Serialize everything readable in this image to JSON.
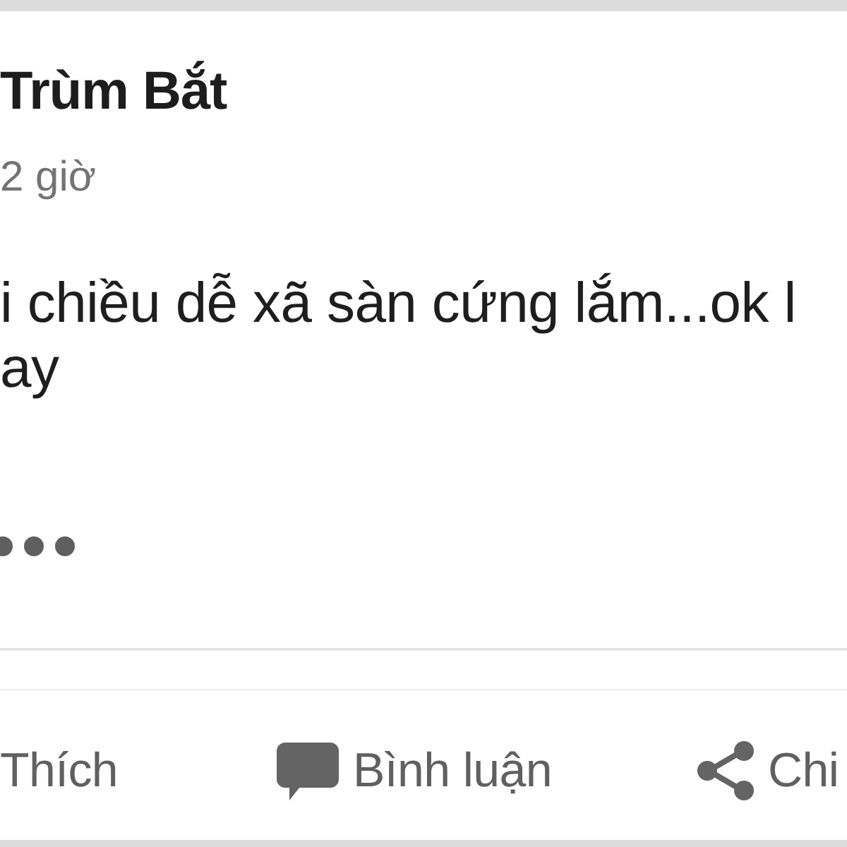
{
  "post": {
    "author": "Trùm Bắt",
    "time": "2 giờ",
    "body": "i chiều dễ xã sàn cứng lắm...ok l\nay"
  },
  "actions": [
    {
      "kind": "like",
      "label": "Thích"
    },
    {
      "kind": "comment",
      "label": "Bình luận"
    },
    {
      "kind": "share",
      "label": "Chi"
    }
  ]
}
